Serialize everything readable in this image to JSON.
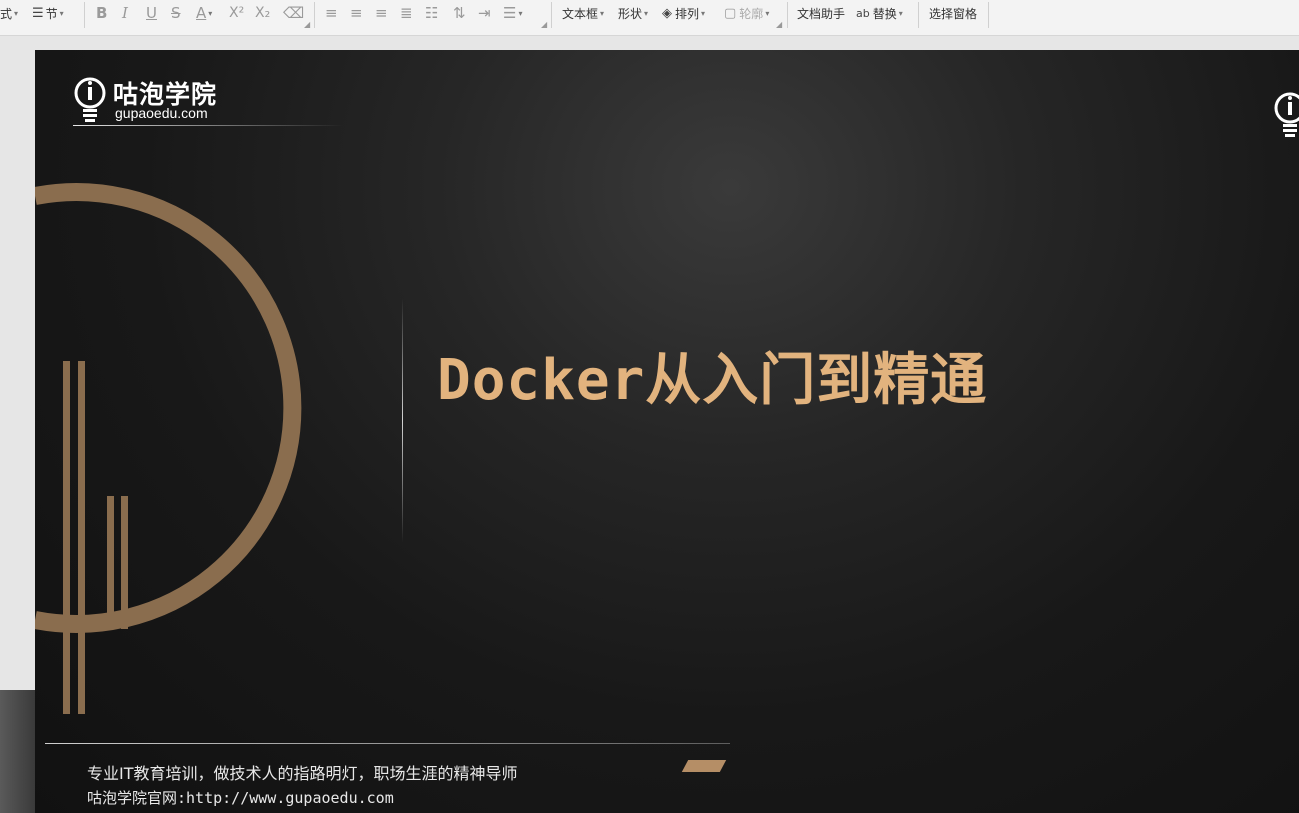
{
  "toolbar": {
    "style_label": "式",
    "section_label": "节",
    "textbox_label": "文本框",
    "shape_label": "形状",
    "arrange_label": "排列",
    "outline_label": "轮廓",
    "doc_assistant_label": "文档助手",
    "replace_label": "替换",
    "selection_pane_label": "选择窗格",
    "bold_glyph": "B",
    "italic_glyph": "I",
    "underline_glyph": "U",
    "strike_glyph": "S",
    "fontcolor_glyph": "A",
    "superscript_glyph": "X²",
    "subscript_glyph": "X₂"
  },
  "slide": {
    "logo_name": "咕泡学院",
    "logo_domain": "gupaoedu.com",
    "title": "Docker从入门到精通",
    "slogan": "专业IT教育培训，做技术人的指路明灯，职场生涯的精神导师",
    "website": "咕泡学院官网:http://www.gupaoedu.com",
    "accent_color": "#e2b37e",
    "bronze_color": "#8a6d4e"
  }
}
